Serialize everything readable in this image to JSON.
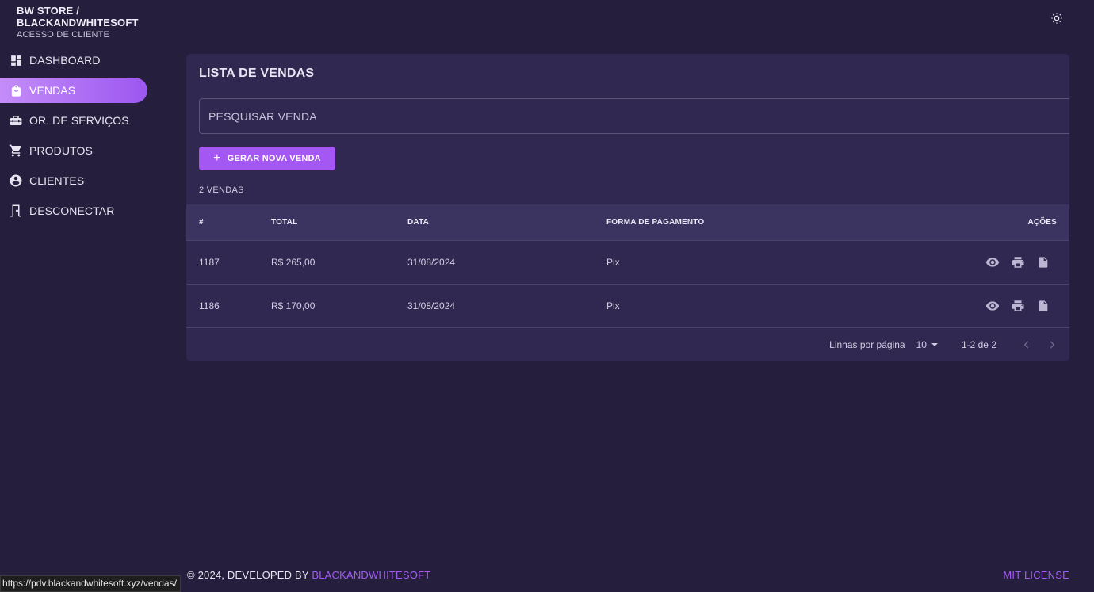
{
  "brand": {
    "line1": "BW STORE /",
    "line2": "BLACKANDWHITESOFT",
    "subtitle": "ACESSO DE CLIENTE"
  },
  "header": {
    "theme_icon": "sun-icon"
  },
  "sidebar": {
    "items": [
      {
        "label": "DASHBOARD",
        "icon": "dashboard-icon",
        "active": false
      },
      {
        "label": "VENDAS",
        "icon": "shopping-bag-icon",
        "active": true
      },
      {
        "label": "OR. DE SERVIÇOS",
        "icon": "toolbox-icon",
        "active": false
      },
      {
        "label": "PRODUTOS",
        "icon": "cart-icon",
        "active": false
      },
      {
        "label": "CLIENTES",
        "icon": "account-circle-icon",
        "active": false
      },
      {
        "label": "DESCONECTAR",
        "icon": "exit-door-icon",
        "active": false
      }
    ]
  },
  "main": {
    "title": "LISTA DE VENDAS",
    "search_placeholder": "PESQUISAR VENDA",
    "new_button_label": "GERAR NOVA VENDA",
    "count_label": "2 VENDAS",
    "table": {
      "columns": [
        "#",
        "TOTAL",
        "DATA",
        "FORMA DE PAGAMENTO",
        "AÇÕES"
      ],
      "rows": [
        {
          "id": "1187",
          "total": "R$ 265,00",
          "date": "31/08/2024",
          "payment": "Pix"
        },
        {
          "id": "1186",
          "total": "R$ 170,00",
          "date": "31/08/2024",
          "payment": "Pix"
        }
      ],
      "row_actions": [
        "eye-icon",
        "printer-icon",
        "document-icon"
      ]
    },
    "pagination": {
      "rows_per_page_label": "Linhas por página",
      "rows_per_page": "10",
      "range": "1-2 de 2"
    }
  },
  "footer": {
    "prefix": "© 2024, DEVELOPED BY ",
    "link": "BLACKANDWHITESOFT",
    "license": "MIT LICENSE"
  },
  "status_bar": {
    "url": "https://pdv.blackandwhitesoft.xyz/vendas/"
  },
  "colors": {
    "background": "#251f3d",
    "card": "#302850",
    "accent": "#a457f2",
    "active_gradient_start": "#c48cf8",
    "active_gradient_end": "#9c57f0"
  }
}
